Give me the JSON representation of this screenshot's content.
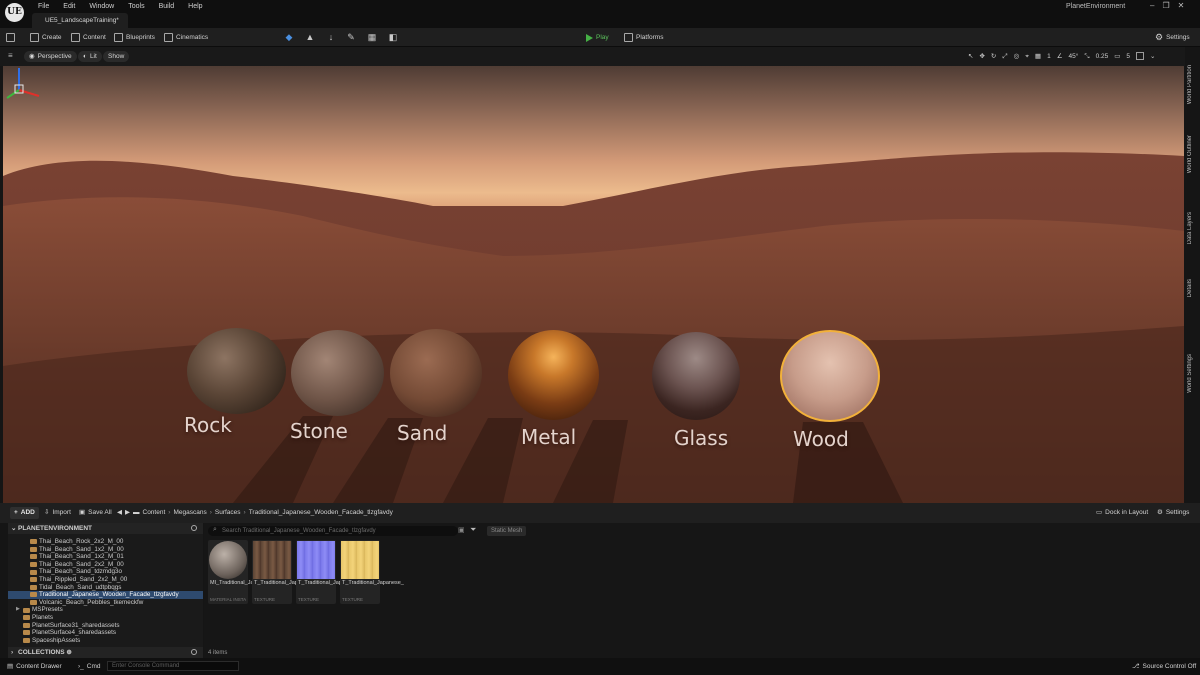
{
  "app": {
    "logo": "UE",
    "menus": [
      "File",
      "Edit",
      "Window",
      "Tools",
      "Build",
      "Help"
    ],
    "level_tab": "UE5_LandscapeTraining*",
    "project_name": "PlanetEnvironment",
    "window_controls": [
      "–",
      "❐",
      "✕"
    ]
  },
  "toolbar": {
    "create": "Create",
    "content": "Content",
    "blueprints": "Blueprints",
    "cinematics": "Cinematics",
    "play": "Play",
    "platforms": "Platforms",
    "settings": "Settings"
  },
  "viewport": {
    "perspective": "Perspective",
    "lit": "Lit",
    "show": "Show",
    "fov": "45°",
    "grid_snap": "1",
    "scale_snap": "0.25",
    "camera_speed": "5",
    "materials": [
      "Rock",
      "Stone",
      "Sand",
      "Metal",
      "Glass",
      "Wood"
    ],
    "colors": {
      "selection": "#f2b13a",
      "gizmo_x": "#e0302a",
      "gizmo_y": "#3db83d",
      "gizmo_z": "#2f6fe8"
    }
  },
  "side_tabs": [
    "World Partition",
    "World Outliner",
    "Data Layers",
    "Details",
    "World Settings"
  ],
  "content_browser": {
    "add": "ADD",
    "import": "Import",
    "save_all": "Save All",
    "breadcrumb": [
      "Content",
      "Megascans",
      "Surfaces",
      "Traditional_Japanese_Wooden_Facade_tlzgfavdy"
    ],
    "dock": "Dock in Layout",
    "settings": "Settings",
    "sources_header": "PLANETENVIRONMENT",
    "tree": [
      "Thai_Beach_Rock_2x2_M_00",
      "Thai_Beach_Sand_1x2_M_00",
      "Thai_Beach_Sand_1x2_M_01",
      "Thai_Beach_Sand_2x2_M_00",
      "Thai_Beach_Sand_tdzmdg3o",
      "Thai_Rippled_Sand_2x2_M_00",
      "Tidal_Beach_Sand_udtpbqgs",
      "Traditional_Japanese_Wooden_Facade_tlzgfavdy",
      "Volcanic_Beach_Pebbles_tkemeckfw",
      "MSPresets",
      "Planets",
      "PlanetSurface31_sharedassets",
      "PlanetSurface4_sharedassets",
      "SpaceshipAssets"
    ],
    "collections": "COLLECTIONS",
    "search_placeholder": "Search Traditional_Japanese_Wooden_Facade_tlzgfavdy",
    "filter": "Static Mesh",
    "assets": [
      {
        "name": "MI_Traditional_Japanese_",
        "type": "MATERIAL INSTA"
      },
      {
        "name": "T_Traditional_Japanese_",
        "type": "TEXTURE"
      },
      {
        "name": "T_Traditional_Japanese_",
        "type": "TEXTURE"
      },
      {
        "name": "T_Traditional_Japanese_",
        "type": "TEXTURE"
      }
    ],
    "item_count": "4 items"
  },
  "statusbar": {
    "content_drawer": "Content Drawer",
    "cmd": "Cmd",
    "console_placeholder": "Enter Console Command",
    "source_control": "Source Control Off"
  }
}
